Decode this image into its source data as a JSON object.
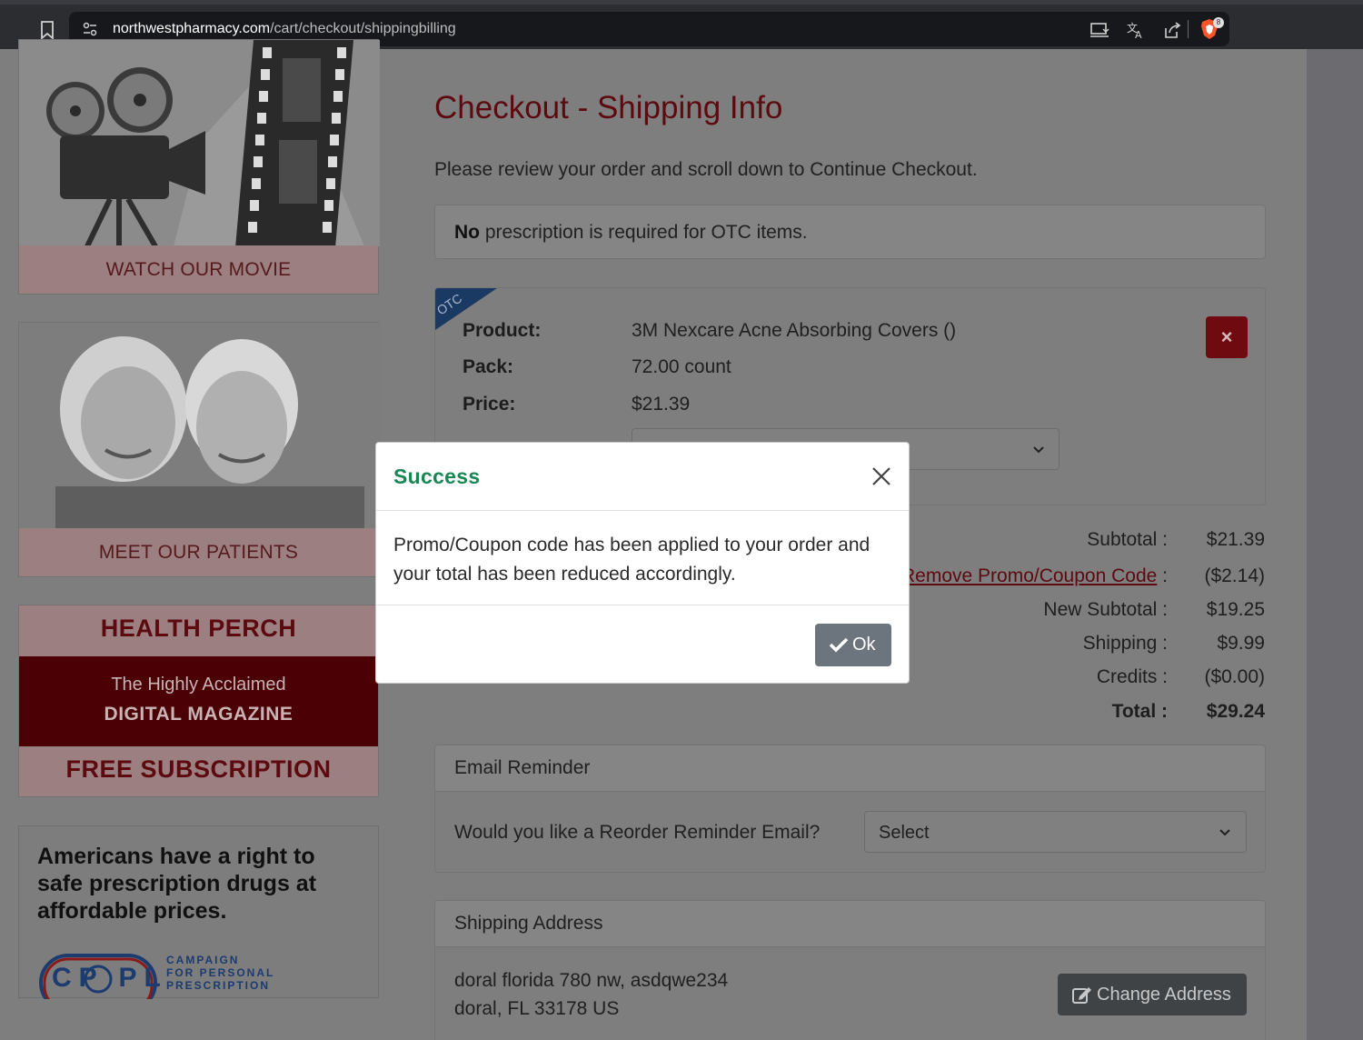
{
  "browser": {
    "url_domain": "northwestpharmacy.com",
    "url_path": "/cart/checkout/shippingbilling",
    "brave_badge": "8"
  },
  "sidebar": {
    "movie_caption": "WATCH OUR MOVIE",
    "patients_caption": "MEET OUR PATIENTS",
    "perch_title": "HEALTH PERCH",
    "perch_sub1": "The Highly Acclaimed",
    "perch_sub2": "DIGITAL MAGAZINE",
    "perch_free": "FREE SUBSCRIPTION",
    "rights_text": "Americans have a right to safe prescription drugs at affordable prices.",
    "cppl_short": "CP PL",
    "cppl_line1": "CAMPAIGN",
    "cppl_line2": "FOR PERSONAL",
    "cppl_line3": "PRESCRIPTION"
  },
  "main": {
    "title": "Checkout - Shipping Info",
    "intro": "Please review your order and scroll down to Continue Checkout.",
    "notice_bold": "No",
    "notice_rest": " prescription is required for OTC items.",
    "otc_tag": "OTC",
    "product": {
      "product_label": "Product:",
      "product_value": "3M Nexcare Acne Absorbing Covers ()",
      "pack_label": "Pack:",
      "pack_value": "72.00 count",
      "price_label": "Price:",
      "price_value": "$21.39",
      "delete_symbol": "×"
    },
    "totals": {
      "subtotal_label": "Subtotal :",
      "subtotal_value": "$21.39",
      "promo_link": "Remove Promo/Coupon Code",
      "promo_colon": " :",
      "promo_value": "($2.14)",
      "new_subtotal_label": "New Subtotal :",
      "new_subtotal_value": "$19.25",
      "shipping_label": "Shipping :",
      "shipping_value": "$9.99",
      "credits_label": "Credits :",
      "credits_value": "($0.00)",
      "total_label": "Total :",
      "total_value": "$29.24"
    },
    "reminder": {
      "header": "Email Reminder",
      "question": "Would you like a Reorder Reminder Email?",
      "select_value": "Select"
    },
    "shipping": {
      "header": "Shipping Address",
      "line1": "doral florida 780 nw, asdqwe234",
      "line2": "doral, FL 33178 US",
      "change_button": "Change Address"
    }
  },
  "modal": {
    "title": "Success",
    "body": "Promo/Coupon code has been applied to your order and your total has been reduced accordingly.",
    "ok_label": "Ok"
  },
  "colors": {
    "brand": "#6e0a10",
    "success": "#198754",
    "secondary_button": "#6c757d"
  }
}
